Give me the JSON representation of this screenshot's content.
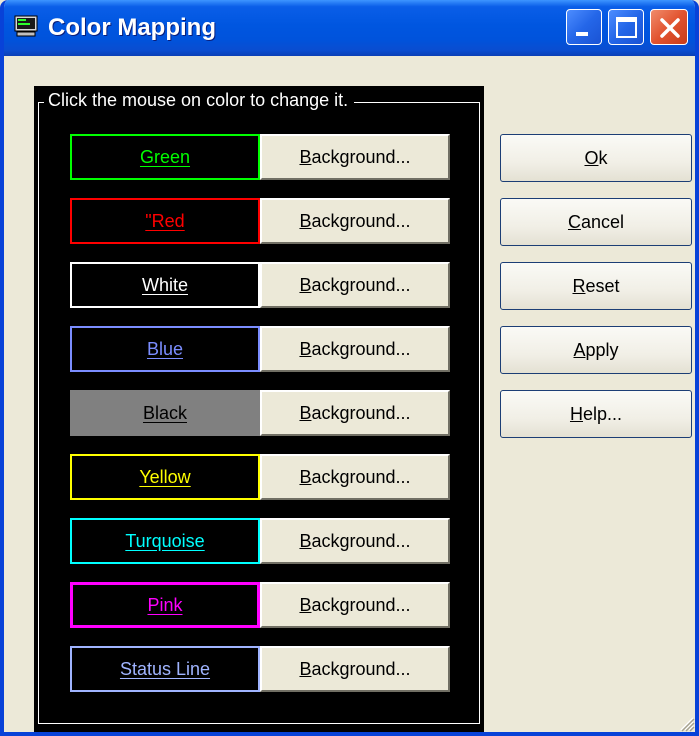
{
  "window": {
    "title": "Color Mapping"
  },
  "titlebar_buttons": {
    "minimize": "minimize-icon",
    "maximize": "maximize-icon",
    "close": "close-icon"
  },
  "group": {
    "label": "Click the mouse on color to change it."
  },
  "rows": [
    {
      "label": "Green",
      "access": "G",
      "rest": "reen",
      "color": "#00ff00",
      "bg": "#000000",
      "selected": false,
      "button_access": "B",
      "button_rest": "ackground..."
    },
    {
      "label": "\"Red",
      "access": "R",
      "prefix": "\"",
      "rest": "ed",
      "color": "#ff0000",
      "bg": "#000000",
      "selected": false,
      "button_access": "B",
      "button_rest": "ackground..."
    },
    {
      "label": "White",
      "access": "W",
      "rest": "hite",
      "color": "#ffffff",
      "bg": "#000000",
      "selected": false,
      "button_access": "B",
      "button_rest": "ackground..."
    },
    {
      "label": "Blue",
      "access": "B",
      "rest": "lue",
      "color": "#7b8dff",
      "bg": "#000000",
      "selected": false,
      "button_access": "B",
      "button_rest": "ackground..."
    },
    {
      "label": "Black",
      "access": "B",
      "rest": "lack",
      "color": "#000000",
      "bg": "#808080",
      "selected": false,
      "button_access": "B",
      "button_rest": "ackground..."
    },
    {
      "label": "Yellow",
      "access": "Y",
      "rest": "ellow",
      "color": "#ffff00",
      "bg": "#000000",
      "selected": false,
      "button_access": "B",
      "button_rest": "ackground..."
    },
    {
      "label": "Turquoise",
      "access": "T",
      "rest": "urquoise",
      "color": "#00ffff",
      "bg": "#000000",
      "selected": false,
      "button_access": "B",
      "button_rest": "ackground..."
    },
    {
      "label": "Pink",
      "access": "P",
      "rest": "ink",
      "color": "#ff00ff",
      "bg": "#000000",
      "selected": true,
      "button_access": "B",
      "button_rest": "ackground..."
    },
    {
      "label": "Status Line",
      "access": "S",
      "rest": "tatus Line",
      "color": "#a0b4ff",
      "bg": "#000000",
      "selected": false,
      "button_access": "B",
      "button_rest": "ackground..."
    }
  ],
  "actions": [
    {
      "id": "ok",
      "access": "O",
      "rest": "k"
    },
    {
      "id": "cancel",
      "access": "C",
      "rest": "ancel"
    },
    {
      "id": "reset",
      "access": "R",
      "rest": "eset"
    },
    {
      "id": "apply",
      "access": "A",
      "rest": "pply"
    },
    {
      "id": "help",
      "access": "H",
      "rest": "elp..."
    }
  ],
  "colors": {
    "titlebar": "#0054e3",
    "face": "#ece9d8",
    "panel": "#000000"
  }
}
